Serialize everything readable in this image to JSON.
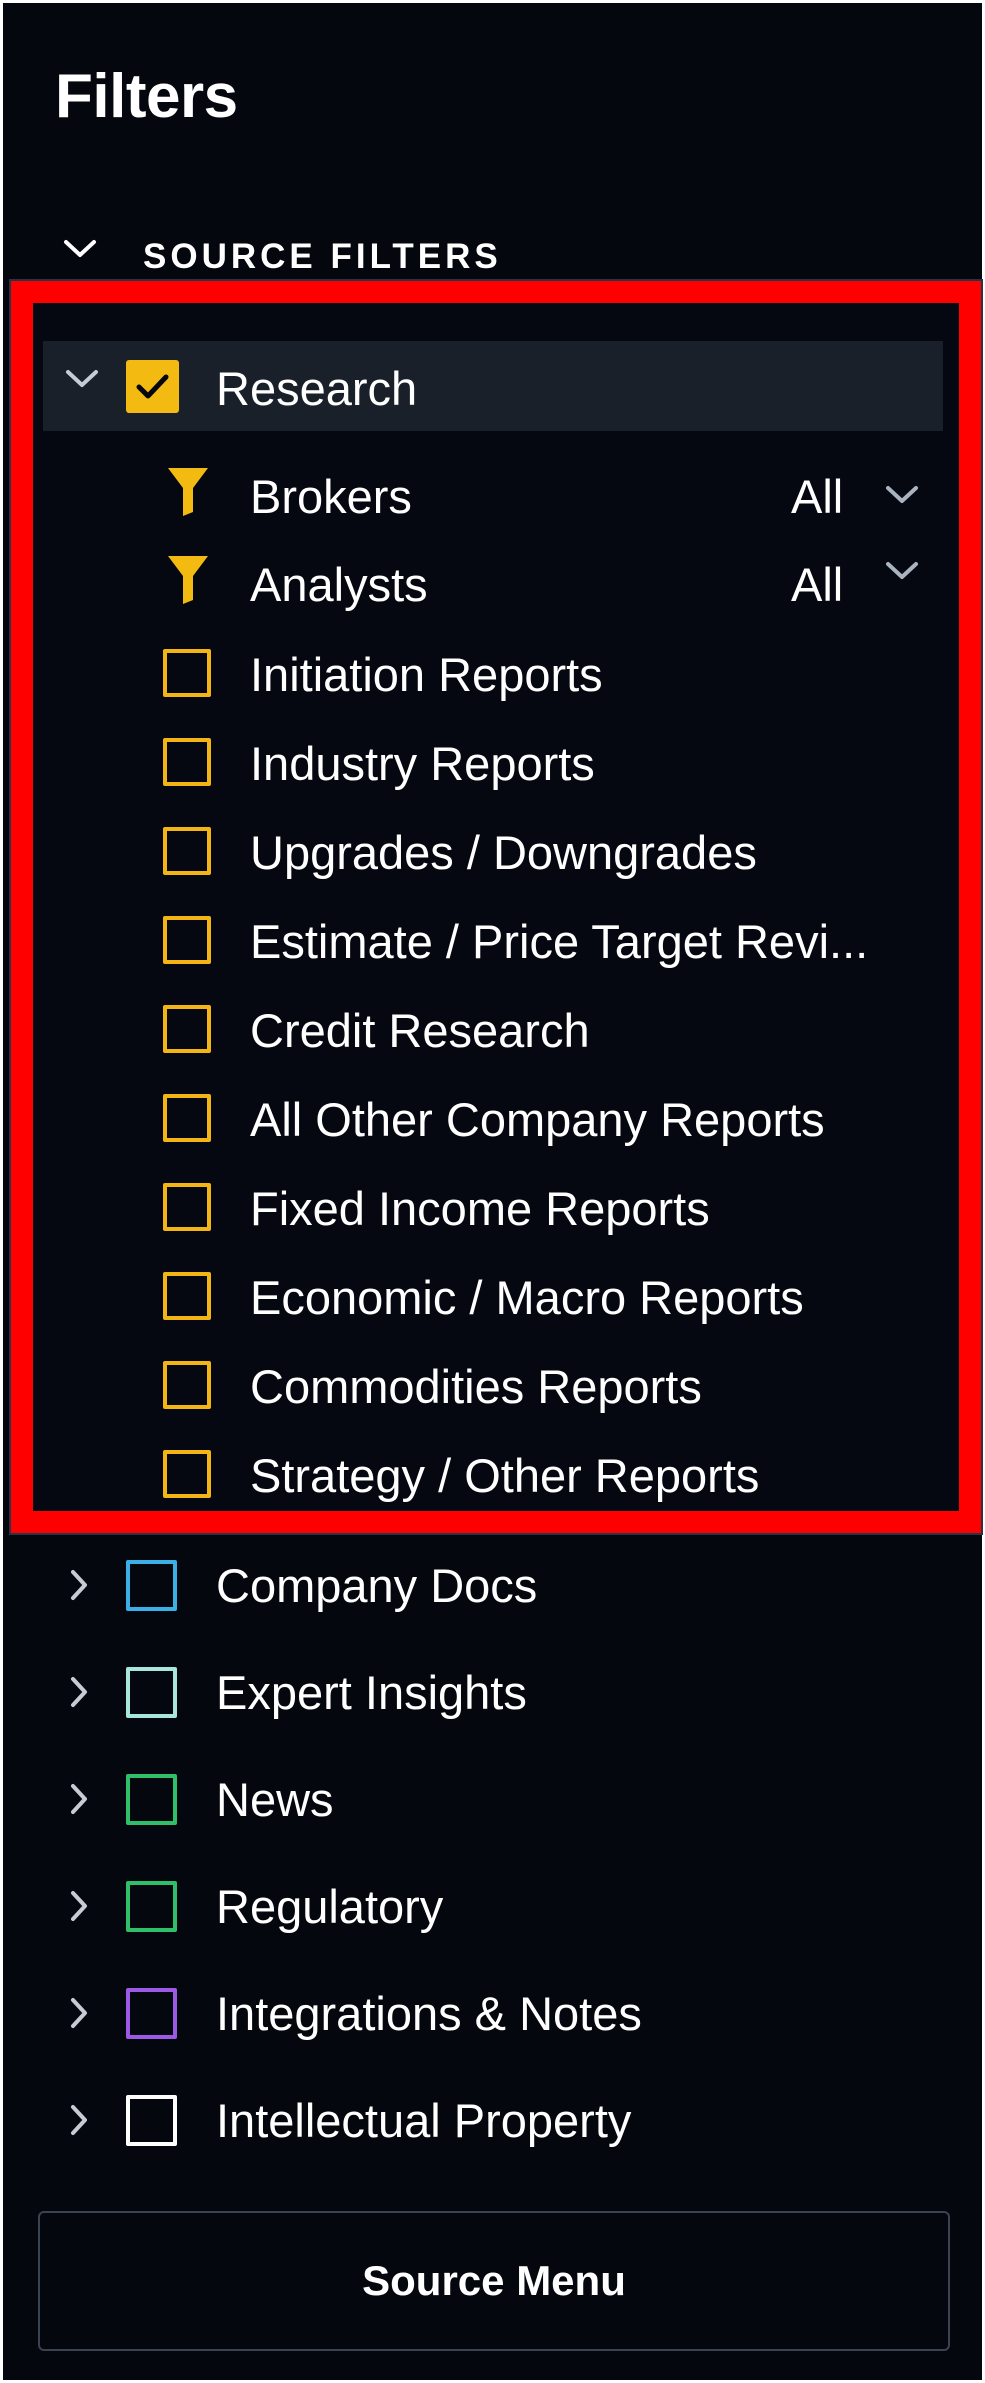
{
  "header": {
    "title": "Filters"
  },
  "section": {
    "label": "SOURCE FILTERS"
  },
  "research": {
    "label": "Research",
    "checked": true,
    "brokers": {
      "label": "Brokers",
      "value": "All"
    },
    "analysts": {
      "label": "Analysts",
      "value": "All"
    },
    "report_types": [
      {
        "label": "Initiation Reports",
        "checked": false
      },
      {
        "label": "Industry Reports",
        "checked": false
      },
      {
        "label": "Upgrades / Downgrades",
        "checked": false
      },
      {
        "label": "Estimate / Price Target Revi...",
        "checked": false
      },
      {
        "label": "Credit Research",
        "checked": false
      },
      {
        "label": "All Other Company Reports",
        "checked": false
      },
      {
        "label": "Fixed Income Reports",
        "checked": false
      },
      {
        "label": "Economic / Macro Reports",
        "checked": false
      },
      {
        "label": "Commodities Reports",
        "checked": false
      },
      {
        "label": "Strategy / Other Reports",
        "checked": false
      }
    ]
  },
  "categories": [
    {
      "label": "Company Docs",
      "color": "#3ab0e6",
      "checked": false
    },
    {
      "label": "Expert Insights",
      "color": "#a8e6dc",
      "checked": false
    },
    {
      "label": "News",
      "color": "#2fbf6a",
      "checked": false
    },
    {
      "label": "Regulatory",
      "color": "#2fbf6a",
      "checked": false
    },
    {
      "label": "Integrations & Notes",
      "color": "#9b59e6",
      "checked": false
    },
    {
      "label": "Intellectual Property",
      "color": "#ffffff",
      "checked": false
    }
  ],
  "footer": {
    "source_menu_label": "Source Menu"
  },
  "colors": {
    "background": "#04070d",
    "accent_yellow": "#f3bb11",
    "highlight_red": "#ff0000",
    "text": "#ffffff"
  }
}
